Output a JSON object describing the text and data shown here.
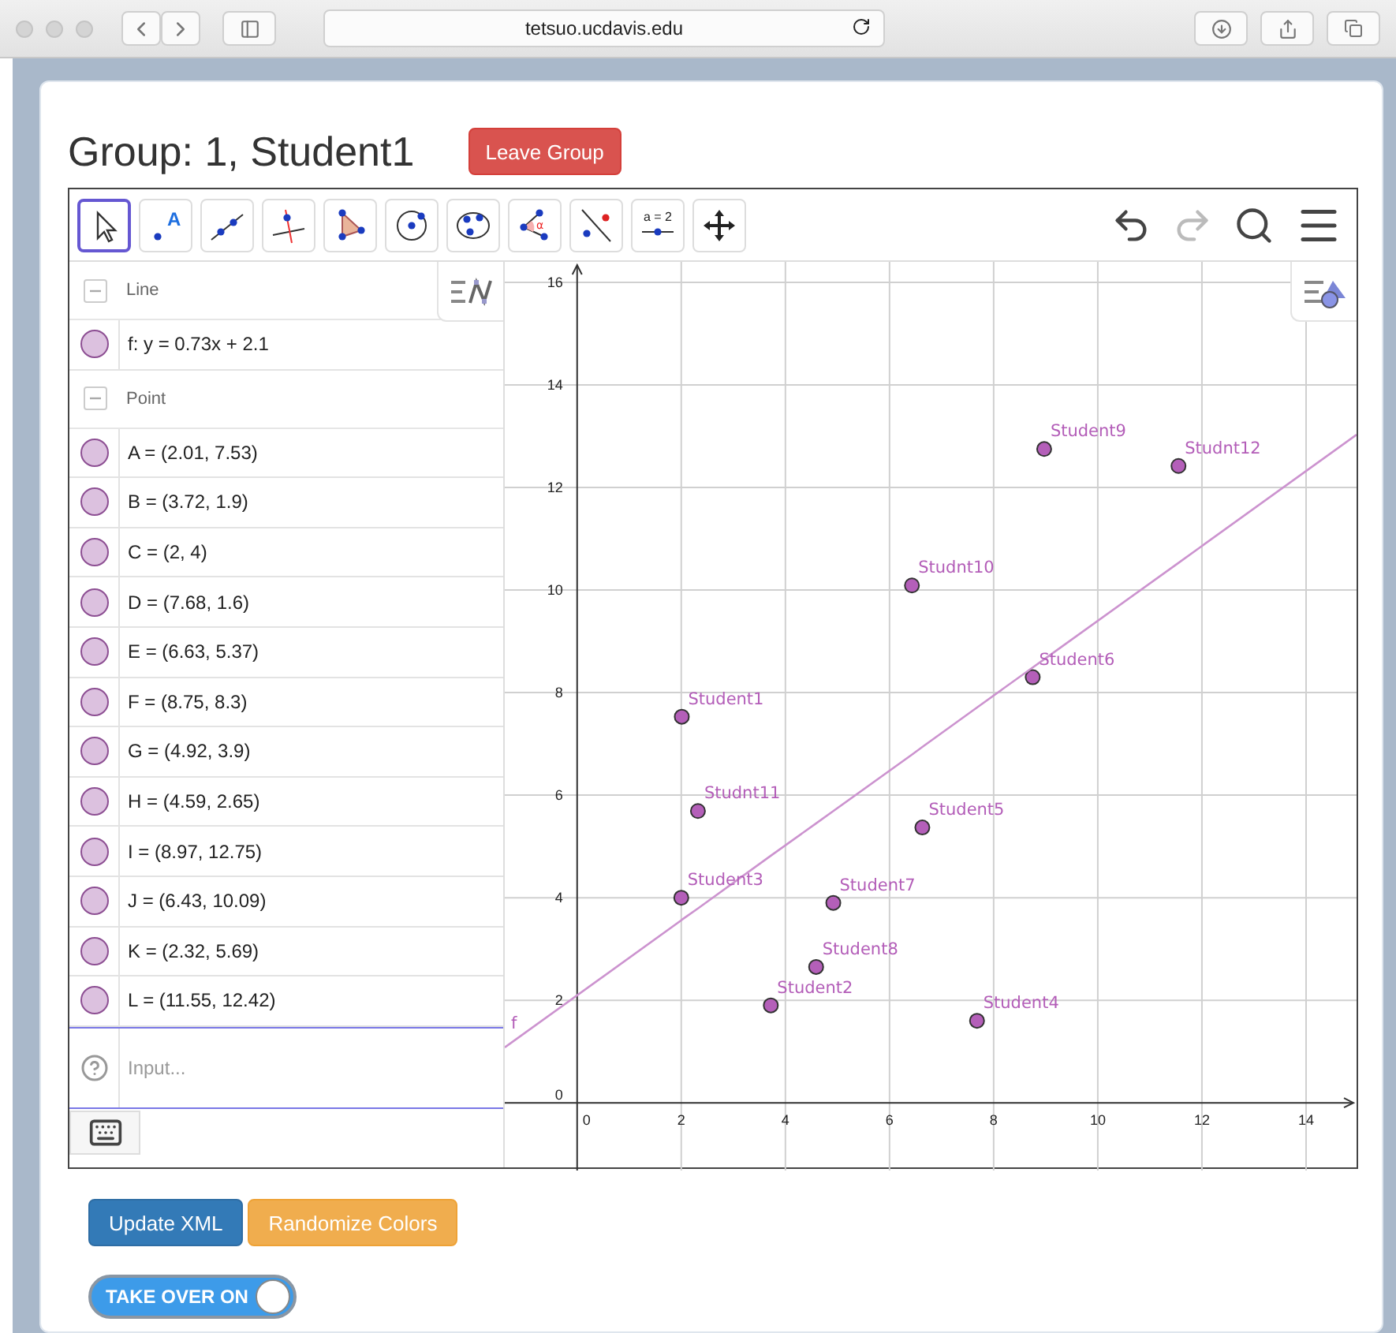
{
  "browser": {
    "address": "tetsuo.ucdavis.edu"
  },
  "header": {
    "title": "Group: 1, Student1",
    "leave_button": "Leave Group"
  },
  "toolbar": {
    "tools": [
      {
        "kind": "move",
        "selected": true
      },
      {
        "kind": "point",
        "label": "A",
        "selected": false
      },
      {
        "kind": "line",
        "selected": false
      },
      {
        "kind": "perpendicular",
        "selected": false
      },
      {
        "kind": "polygon",
        "selected": false
      },
      {
        "kind": "circle",
        "selected": false
      },
      {
        "kind": "conic",
        "selected": false
      },
      {
        "kind": "angle",
        "label": "α",
        "selected": false
      },
      {
        "kind": "reflect",
        "selected": false
      },
      {
        "kind": "slider",
        "label": "a = 2",
        "selected": false
      },
      {
        "kind": "pan",
        "selected": false
      }
    ]
  },
  "algebra": {
    "groups": [
      {
        "title": "Line",
        "expanded": true,
        "items": [
          {
            "text": "f: y = 0.73x + 2.1",
            "shown": true
          }
        ]
      },
      {
        "title": "Point",
        "expanded": true,
        "items": [
          {
            "text": "A = (2.01, 7.53)",
            "shown": true
          },
          {
            "text": "B = (3.72, 1.9)",
            "shown": true
          },
          {
            "text": "C = (2, 4)",
            "shown": true
          },
          {
            "text": "D = (7.68, 1.6)",
            "shown": true
          },
          {
            "text": "E = (6.63, 5.37)",
            "shown": true
          },
          {
            "text": "F = (8.75, 8.3)",
            "shown": true
          },
          {
            "text": "G = (4.92, 3.9)",
            "shown": true
          },
          {
            "text": "H = (4.59, 2.65)",
            "shown": true
          },
          {
            "text": "I = (8.97, 12.75)",
            "shown": true
          },
          {
            "text": "J = (6.43, 10.09)",
            "shown": true
          },
          {
            "text": "K = (2.32, 5.69)",
            "shown": true
          },
          {
            "text": "L = (11.55, 12.42)",
            "shown": true
          }
        ]
      }
    ],
    "input": {
      "placeholder": "Input..."
    }
  },
  "graphics": {
    "chart_data": {
      "type": "scatter",
      "x": [
        -1.39,
        2.01,
        3.72,
        2,
        7.68,
        6.63,
        8.75,
        4.92,
        4.59,
        8.97,
        6.43,
        2.32,
        11.55,
        14.97
      ],
      "series": [
        {
          "color": "#b45fb9",
          "values": [
            null,
            7.53,
            1.9,
            4,
            1.6,
            5.37,
            8.3,
            3.9,
            2.65,
            12.75,
            10.09,
            5.69,
            12.42,
            null
          ]
        },
        {
          "name": "f",
          "type": "line",
          "color": "#cc93cf",
          "values": [
            1.08,
            3.57,
            4.82,
            3.56,
            7.71,
            6.94,
            8.49,
            5.69,
            5.45,
            8.65,
            6.79,
            3.79,
            10.53,
            13.03
          ]
        }
      ],
      "grid": true,
      "xlim": [
        -1.39,
        14.97
      ],
      "ylim": [
        -1.32,
        16.4
      ],
      "xticks": [
        0,
        2,
        4,
        6,
        8,
        10,
        12,
        14
      ],
      "yticks": [
        0,
        2,
        4,
        6,
        8,
        10,
        12,
        14,
        16
      ],
      "annotations": [
        {
          "x": 2.01,
          "y": 7.53,
          "text": "Student1"
        },
        {
          "x": 3.72,
          "y": 1.9,
          "text": "Student2"
        },
        {
          "x": 2,
          "y": 4,
          "text": "Student3"
        },
        {
          "x": 7.68,
          "y": 1.6,
          "text": "Student4"
        },
        {
          "x": 6.63,
          "y": 5.37,
          "text": "Student5"
        },
        {
          "x": 8.75,
          "y": 8.3,
          "text": "Student6"
        },
        {
          "x": 4.92,
          "y": 3.9,
          "text": "Student7"
        },
        {
          "x": 4.59,
          "y": 2.65,
          "text": "Student8"
        },
        {
          "x": 8.97,
          "y": 12.75,
          "text": "Student9"
        },
        {
          "x": 6.43,
          "y": 10.09,
          "text": "Studnt10"
        },
        {
          "x": 2.32,
          "y": 5.69,
          "text": "Studnt11"
        },
        {
          "x": 11.55,
          "y": 12.42,
          "text": "Studnt12"
        }
      ]
    }
  },
  "buttons": [
    {
      "label": "Update XML",
      "kind": "primary"
    },
    {
      "label": "Randomize Colors",
      "kind": "warning"
    }
  ],
  "toggle": {
    "label": "TAKE OVER ON",
    "on": true
  }
}
